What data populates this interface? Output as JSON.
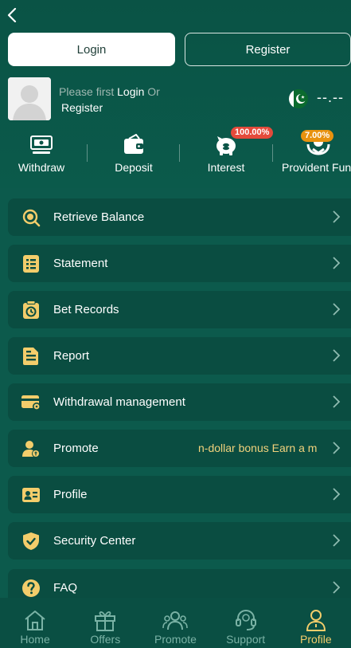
{
  "header": {
    "login_label": "Login",
    "register_label": "Register",
    "prompt_prefix": "Please first",
    "prompt_login": "Login",
    "prompt_or": "Or",
    "prompt_register": "Register",
    "balance": "--.--",
    "flag_icon": "pakistan-flag-icon"
  },
  "quick_actions": [
    {
      "label": "Withdraw",
      "icon": "withdraw-icon"
    },
    {
      "label": "Deposit",
      "icon": "wallet-icon"
    },
    {
      "label": "Interest",
      "icon": "piggy-bank-icon",
      "badge": "100.00%"
    },
    {
      "label": "Provident Fund",
      "icon": "provident-fund-icon",
      "badge": "7.00%"
    }
  ],
  "menu": {
    "items": [
      {
        "label": "Retrieve Balance",
        "icon": "coin-search-icon"
      },
      {
        "label": "Statement",
        "icon": "statement-icon"
      },
      {
        "label": "Bet Records",
        "icon": "clipboard-clock-icon"
      },
      {
        "label": "Report",
        "icon": "report-icon"
      },
      {
        "label": "Withdrawal management",
        "icon": "card-gear-icon"
      },
      {
        "label": "Promote",
        "icon": "user-money-icon",
        "marquee": "n-dollar bonus  Earn a m"
      },
      {
        "label": "Profile",
        "icon": "id-card-icon"
      },
      {
        "label": "Security Center",
        "icon": "shield-check-icon"
      },
      {
        "label": "FAQ",
        "icon": "question-icon"
      }
    ]
  },
  "nav": {
    "items": [
      {
        "label": "Home",
        "icon": "home-icon"
      },
      {
        "label": "Offers",
        "icon": "gift-icon"
      },
      {
        "label": "Promote",
        "icon": "team-icon"
      },
      {
        "label": "Support",
        "icon": "headset-icon"
      },
      {
        "label": "Profile",
        "icon": "profile-icon",
        "active": true
      }
    ]
  },
  "colors": {
    "background": "#0b5447",
    "card": "#0a4d41",
    "accent_gold": "#f3cd6b",
    "badge_red": "#e44a3b",
    "badge_orange": "#e8920f"
  }
}
